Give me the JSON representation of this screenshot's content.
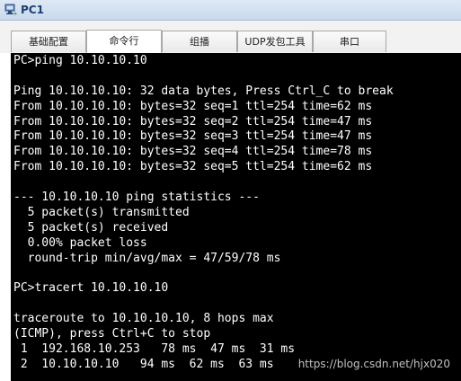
{
  "window": {
    "title": "PC1",
    "icon": "pc-icon"
  },
  "tabs": [
    {
      "label": "基础配置",
      "active": false
    },
    {
      "label": "命令行",
      "active": true
    },
    {
      "label": "组播",
      "active": false
    },
    {
      "label": "UDP发包工具",
      "active": false
    },
    {
      "label": "串口",
      "active": false
    }
  ],
  "terminal": {
    "lines": [
      "PC>ping 10.10.10.10",
      "",
      "Ping 10.10.10.10: 32 data bytes, Press Ctrl_C to break",
      "From 10.10.10.10: bytes=32 seq=1 ttl=254 time=62 ms",
      "From 10.10.10.10: bytes=32 seq=2 ttl=254 time=47 ms",
      "From 10.10.10.10: bytes=32 seq=3 ttl=254 time=47 ms",
      "From 10.10.10.10: bytes=32 seq=4 ttl=254 time=78 ms",
      "From 10.10.10.10: bytes=32 seq=5 ttl=254 time=62 ms",
      "",
      "--- 10.10.10.10 ping statistics ---",
      "  5 packet(s) transmitted",
      "  5 packet(s) received",
      "  0.00% packet loss",
      "  round-trip min/avg/max = 47/59/78 ms",
      "",
      "PC>tracert 10.10.10.10",
      "",
      "traceroute to 10.10.10.10, 8 hops max",
      "(ICMP), press Ctrl+C to stop",
      " 1  192.168.10.253   78 ms  47 ms  31 ms",
      " 2  10.10.10.10   94 ms  62 ms  63 ms"
    ]
  },
  "watermark": "https://blog.csdn.net/hjx020"
}
